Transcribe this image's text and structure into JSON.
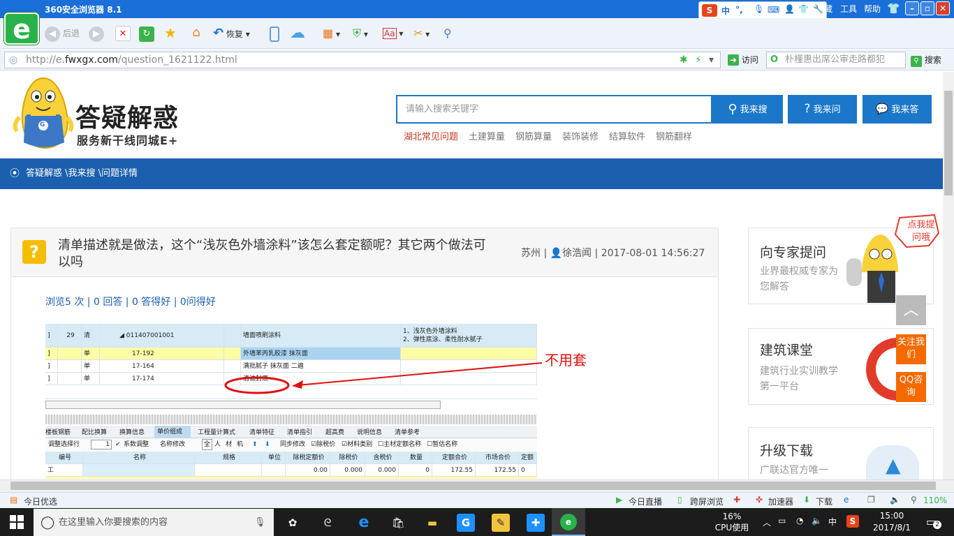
{
  "browser": {
    "title": "360安全浏览器 8.1",
    "menu": [
      "工具",
      "帮助"
    ],
    "menu_partial": "藏",
    "back_label": "后退",
    "restore_label": "恢复",
    "url_prefix": "http://e.",
    "url_domain": "fwxgx.com",
    "url_path": "/question_1621122.html",
    "visit_label": "访问",
    "search_value": "朴槿惠出席公审走路都犯",
    "search_label": "搜索",
    "ime_label": "中",
    "ime_punct": "°,",
    "colors": {
      "titlebar": "#1a6fd8",
      "logo": "#2ab24a"
    }
  },
  "site": {
    "title": "答疑解惑",
    "subtitle": "服务新干线同城E+",
    "mascot_badge": "G",
    "search_placeholder": "请输入搜索关键字",
    "buttons": {
      "search": "我来搜",
      "ask": "我来问",
      "answer": "我来答"
    },
    "hot_links": [
      "湖北常见问题",
      "土建算量",
      "钢筋算量",
      "装饰装修",
      "结算软件",
      "钢筋翻样"
    ],
    "breadcrumb": "答疑解惑 \\我来搜 \\问题详情",
    "accent": "#1b77c9"
  },
  "question": {
    "icon": "?",
    "title": "清单描述就是做法，这个“浅灰色外墙涂料”该怎么套定额呢？其它两个做法可以吗",
    "location": "苏州",
    "author": "徐浩闻",
    "datetime": "2017-08-01 14:56:27",
    "stats": "浏览5 次 | 0 回答 | 0 答得好 | 0问得好"
  },
  "screenshot_sheet": {
    "header_row": {
      "no": "29",
      "kind": "清",
      "code": "011407001001",
      "name": "墙面喷刷涂料",
      "desc_1": "1、浅灰色外墙涂料",
      "desc_2": "2、弹性底涂、柔性耐水腻子"
    },
    "rows": [
      {
        "kind": "单",
        "code": "17-192",
        "name": "外墙苯丙乳胶漆 抹灰面"
      },
      {
        "kind": "单",
        "code": "17-164",
        "name": "满批腻子 抹灰面 二遍"
      },
      {
        "kind": "单",
        "code": "17-174",
        "name": "清油封底"
      }
    ],
    "annotation": "不用套",
    "tabs": [
      "楼板钢筋",
      "配比换算",
      "换算信息",
      "单价组成",
      "工程量计算式",
      "清单特征",
      "清单指引",
      "超高费",
      "说明信息",
      "清单参考"
    ],
    "active_tab": "单价组成",
    "toolbar": {
      "adjust_label": "调整选择行",
      "adjust_value": "1",
      "coef_label": "系数调整",
      "rename_label": "名称修改",
      "filters": [
        "全",
        "人",
        "材",
        "机"
      ],
      "sync_label": "同步修改",
      "tax_label": "除税价",
      "matcat_label": "材料类别",
      "main_label": "主材定额名称",
      "est_label": "暂估名称"
    },
    "columns": [
      "编号",
      "名称",
      "规格",
      "单位",
      "除税定额价",
      "除税价",
      "含税价",
      "数量",
      "定额合价",
      "市场合价",
      "定额"
    ],
    "data_row": [
      "工",
      "",
      "",
      "",
      "0.00",
      "0.000",
      "0.000",
      "0",
      "172.55",
      "172.55",
      "0"
    ]
  },
  "sidebar": {
    "expert": {
      "title": "向专家提问",
      "desc": "业界最权威专家为您解答",
      "bubble": "点我提问哦"
    },
    "course": {
      "title": "建筑课堂",
      "desc": "建筑行业实训教学第一平台",
      "follow": "关注我们",
      "qq": "QQ咨询"
    },
    "download": {
      "title": "升级下载",
      "desc": "广联达官方唯一"
    }
  },
  "statusbar": {
    "left": "今日优选",
    "items": [
      "今日直播",
      "跨屏浏览",
      "加速器",
      "下载"
    ],
    "zoom": "110%"
  },
  "taskbar": {
    "search_placeholder": "在这里输入你要搜索的内容",
    "cpu_value": "16%",
    "cpu_label": "CPU使用",
    "ime": "中",
    "time": "15:00",
    "date": "2017/8/1",
    "notifications": "2"
  }
}
